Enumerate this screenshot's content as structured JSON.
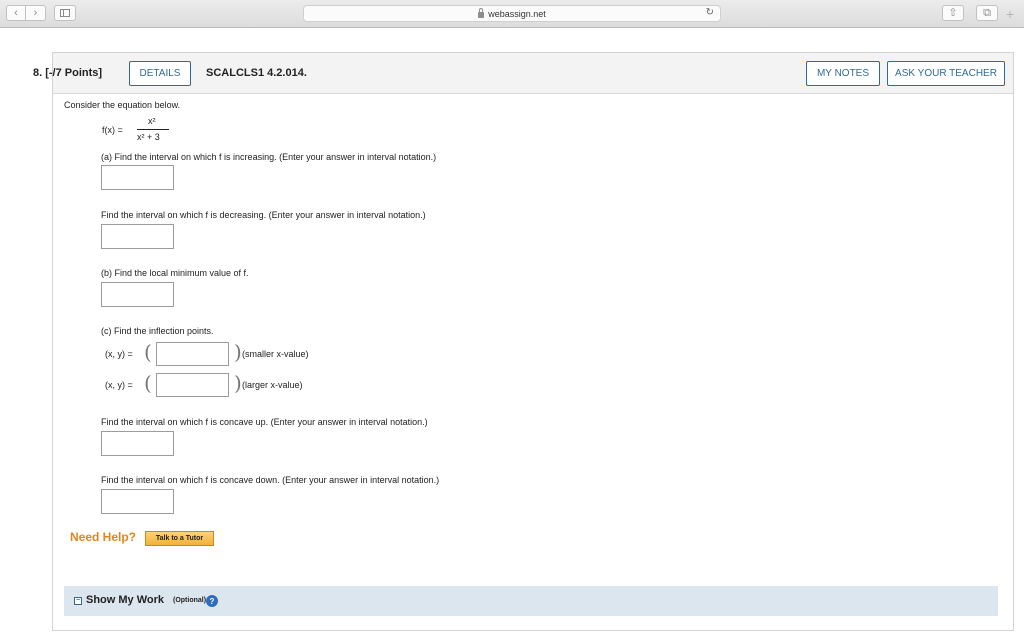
{
  "browser": {
    "back_icon": "‹",
    "forward_icon": "›",
    "url": "webassign.net",
    "reload_icon": "↻",
    "share_icon": "⇧",
    "tabs_icon": "⧉",
    "new_tab_icon": "+"
  },
  "question": {
    "number_label": "8. [-/7 Points]",
    "details_label": "DETAILS",
    "code": "SCALCLS1 4.2.014.",
    "my_notes_label": "MY NOTES",
    "ask_teacher_label": "ASK YOUR TEACHER",
    "intro": "Consider the equation below.",
    "equation": {
      "lhs": "f(x) =",
      "numerator": "x²",
      "denominator": "x² + 3"
    },
    "parts": {
      "a_increasing": "(a) Find the interval on which f is increasing. (Enter your answer in interval notation.)",
      "a_decreasing": "Find the interval on which f is decreasing. (Enter your answer in interval notation.)",
      "b_local_min": "(b) Find the local minimum value of f.",
      "c_inflection": "(c) Find the inflection points.",
      "xy_label": "(x, y) =",
      "smaller_label": "(smaller x-value)",
      "larger_label": "(larger x-value)",
      "concave_up": "Find the interval on which f is concave up. (Enter your answer in interval notation.)",
      "concave_down": "Find the interval on which f is concave down. (Enter your answer in interval notation.)"
    },
    "inputs": {
      "increasing": "",
      "decreasing": "",
      "local_min": "",
      "inflection_smaller": "",
      "inflection_larger": "",
      "concave_up": "",
      "concave_down": ""
    },
    "help": {
      "need_help": "Need Help?",
      "tutor_label": "Talk to a Tutor"
    },
    "show_work": {
      "toggle": "−",
      "label": "Show My Work",
      "optional": "(Optional)",
      "help_icon": "?"
    }
  }
}
